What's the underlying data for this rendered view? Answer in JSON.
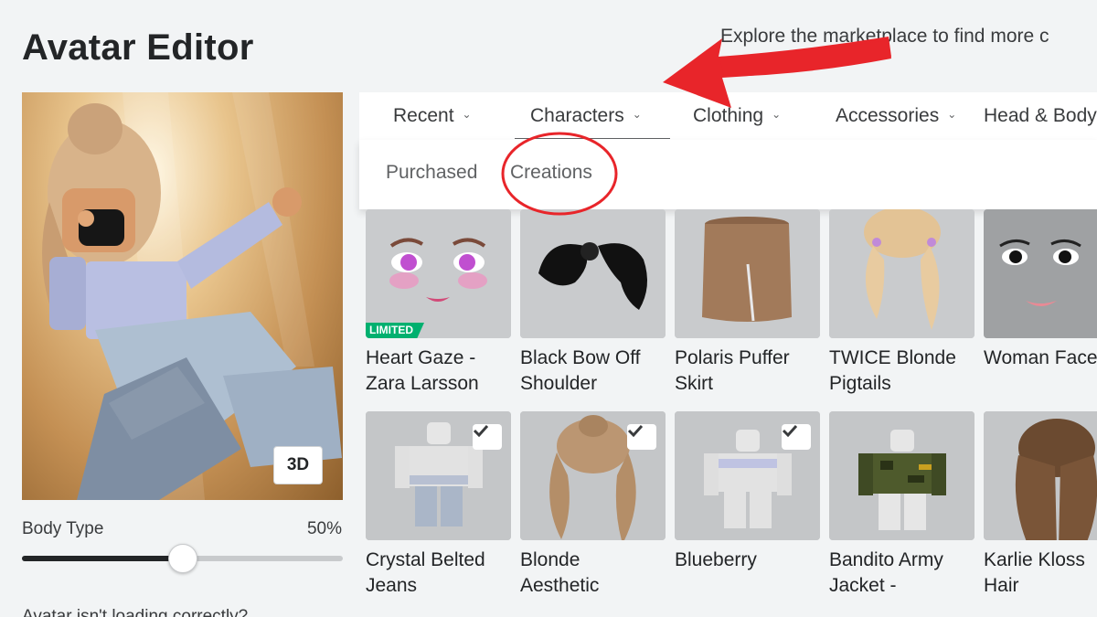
{
  "header": {
    "title": "Avatar Editor",
    "marketplace_hint": "Explore the marketplace to find more c"
  },
  "preview": {
    "view_toggle_label": "3D",
    "body_type_label": "Body Type",
    "body_type_value": "50%",
    "body_type_fraction": 0.5,
    "bottom_note": "Avatar isn't loading correctly?"
  },
  "tabs": [
    {
      "label": "Recent",
      "selected": false
    },
    {
      "label": "Characters",
      "selected": true
    },
    {
      "label": "Clothing",
      "selected": false
    },
    {
      "label": "Accessories",
      "selected": false
    },
    {
      "label": "Head & Body",
      "selected": false
    }
  ],
  "subtabs": [
    {
      "label": "Purchased"
    },
    {
      "label": "Creations"
    }
  ],
  "items": [
    {
      "name_line1": "Heart Gaze -",
      "name_line2": "Zara Larsson",
      "badge": "LIMITED",
      "checked": false,
      "icon": "face-icon"
    },
    {
      "name_line1": "Black Bow Off",
      "name_line2": "Shoulder",
      "checked": false,
      "icon": "bow-icon"
    },
    {
      "name_line1": "Polaris Puffer",
      "name_line2": "Skirt",
      "checked": false,
      "icon": "skirt-icon"
    },
    {
      "name_line1": "TWICE Blonde",
      "name_line2": "Pigtails",
      "checked": false,
      "icon": "pigtails-icon"
    },
    {
      "name_line1": "Woman Face",
      "name_line2": "",
      "checked": false,
      "icon": "woman-face-icon"
    },
    {
      "name_line1": "Crystal Belted",
      "name_line2": "Jeans",
      "checked": true,
      "icon": "jeans-icon"
    },
    {
      "name_line1": "Blonde",
      "name_line2": "Aesthetic",
      "checked": true,
      "icon": "hair-icon"
    },
    {
      "name_line1": "Blueberry",
      "name_line2": "",
      "checked": true,
      "icon": "shirt-icon"
    },
    {
      "name_line1": "Bandito Army",
      "name_line2": "Jacket -",
      "checked": false,
      "icon": "jacket-icon"
    },
    {
      "name_line1": "Karlie Kloss",
      "name_line2": "Hair",
      "checked": false,
      "icon": "brown-hair-icon"
    }
  ],
  "colors": {
    "annotation_red": "#e8252a",
    "limited_green": "#00b06f",
    "tile_gray": "#c4c6c8"
  }
}
